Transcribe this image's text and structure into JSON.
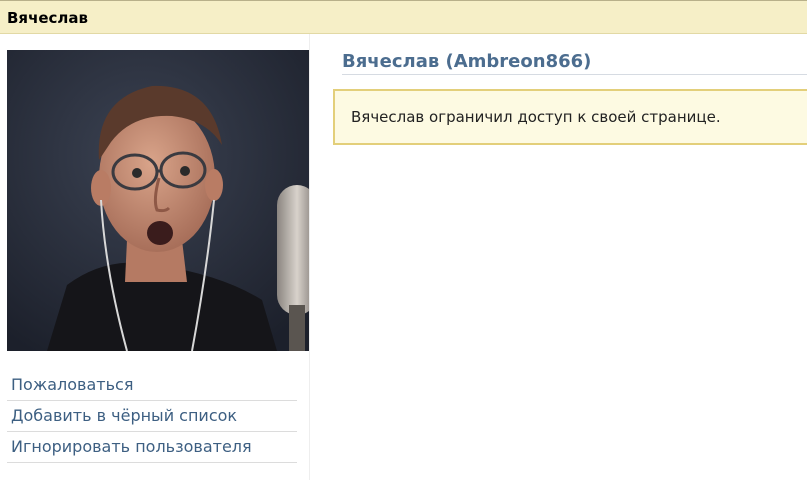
{
  "header": {
    "title": "Вячеслав"
  },
  "profile": {
    "heading": "Вячеслав (Ambreon866)",
    "notice": "Вячеслав ограничил доступ к своей странице.",
    "photo_icon": "profile-photo"
  },
  "actions": [
    {
      "label": "Пожаловаться"
    },
    {
      "label": "Добавить в чёрный список"
    },
    {
      "label": "Игнорировать пользователя"
    }
  ],
  "colors": {
    "header_bg": "#f6efc7",
    "link": "#3d5f82",
    "heading": "#4c6d8f",
    "notice_bg": "#fdfae2",
    "notice_border": "#e3cf7a"
  }
}
